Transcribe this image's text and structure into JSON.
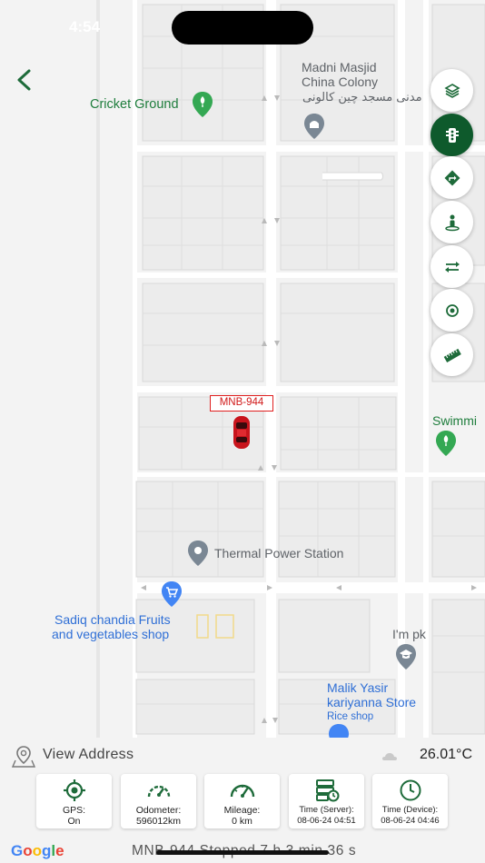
{
  "status_bar": {
    "time": "4:54",
    "battery": ""
  },
  "map": {
    "labels": {
      "cricket_ground": "Cricket Ground",
      "masjid_line1": "Madni Masjid",
      "masjid_line2": "China Colony",
      "masjid_urdu": "مدنی مسجد چین کالونی",
      "swimming": "Swimmi",
      "thermal": "Thermal Power Station",
      "sadiq_line1": "Sadiq chandia Fruits",
      "sadiq_line2": "and vegetables shop",
      "impk": "I'm pk",
      "malik_line1": "Malik Yasir",
      "malik_line2": "kariyanna Store",
      "malik_sub": "Rice shop"
    },
    "vehicle_plate": "MNB-944",
    "colors": {
      "brand_green": "#0e5a2c",
      "poi_green": "#34a853",
      "poi_blue": "#4285f4",
      "vehicle_red": "#d01818"
    }
  },
  "fab_buttons": [
    {
      "name": "layers-button",
      "icon": "layers-icon"
    },
    {
      "name": "traffic-button",
      "icon": "traffic-light-icon",
      "active": true
    },
    {
      "name": "directions-button",
      "icon": "directions-icon"
    },
    {
      "name": "street-view-button",
      "icon": "person-pin-icon"
    },
    {
      "name": "swap-button",
      "icon": "swap-icon"
    },
    {
      "name": "locate-button",
      "icon": "target-icon"
    },
    {
      "name": "ruler-button",
      "icon": "ruler-icon"
    }
  ],
  "bottom": {
    "view_address": "View Address",
    "temperature": "26.01°C",
    "cards": [
      {
        "line1": "GPS:",
        "line2": "On",
        "icon": "gps-target-icon"
      },
      {
        "line1": "Odometer:",
        "line2": "596012km",
        "icon": "odometer-icon"
      },
      {
        "line1": "Mileage:",
        "line2": "0 km",
        "icon": "speedometer-icon"
      },
      {
        "line1": "Time (Server):",
        "line2": "08-06-24 04:51",
        "icon": "server-clock-icon"
      },
      {
        "line1": "Time (Device):",
        "line2": "08-06-24 04:46",
        "icon": "clock-icon"
      }
    ],
    "google": "Google",
    "ticker": "MNB-944      Stopped 7 h 3 min 36 s"
  }
}
